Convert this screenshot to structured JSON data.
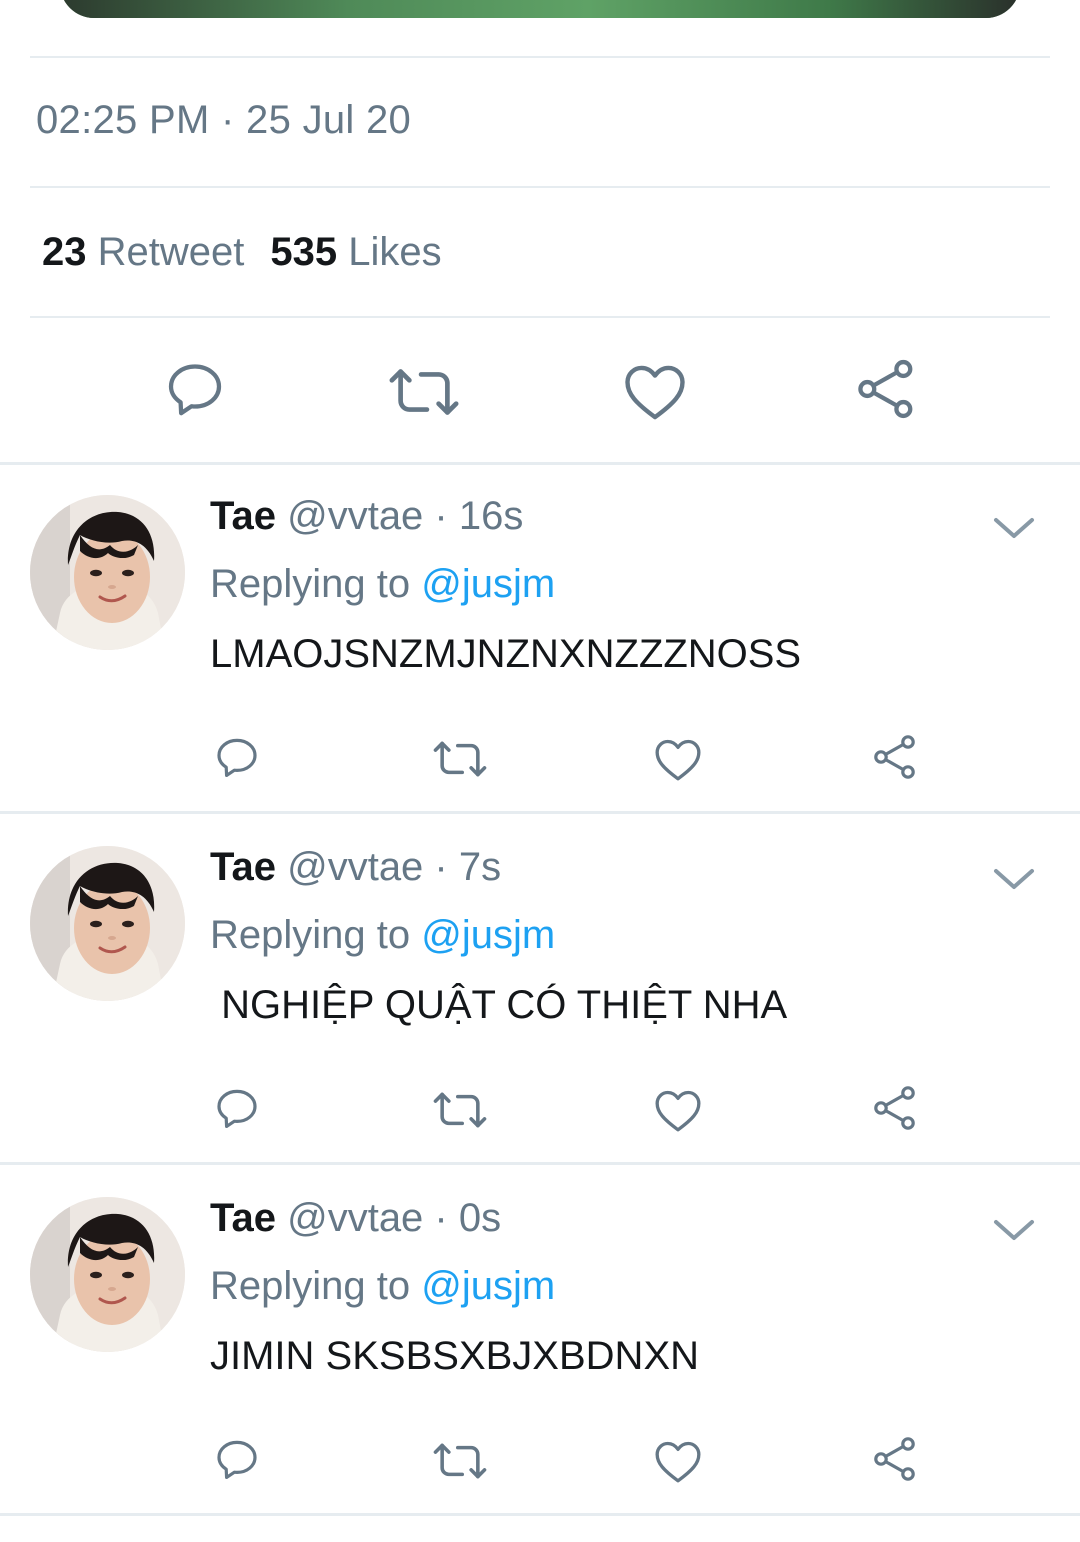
{
  "tweet": {
    "timestamp": "02:25 PM · 25 Jul 20",
    "retweet_count": "23",
    "retweet_label": "Retweet",
    "likes_count": "535",
    "likes_label": "Likes"
  },
  "icons": {
    "reply": "reply-bubble-icon",
    "retweet": "retweet-arrows-icon",
    "like": "heart-icon",
    "share": "share-icon",
    "more": "chevron-down-icon"
  },
  "colors": {
    "text": "#14171a",
    "secondary": "#657786",
    "mention": "#1da1f2",
    "divider": "#e6ecf0",
    "icon": "#657786"
  },
  "replies": [
    {
      "name": "Tae",
      "handle": "@vvtae · 16s",
      "replying_label": "Replying to",
      "replying_to": "@jusjm",
      "text": "LMAOJSNZMJNZNXNZZZNOSS"
    },
    {
      "name": "Tae",
      "handle": "@vvtae · 7s",
      "replying_label": "Replying to",
      "replying_to": "@jusjm",
      "text": " NGHIỆP QUẬT CÓ THIỆT NHA"
    },
    {
      "name": "Tae",
      "handle": "@vvtae · 0s",
      "replying_label": "Replying to",
      "replying_to": "@jusjm",
      "text": "JIMIN SKSBSXBJXBDNXN"
    }
  ]
}
